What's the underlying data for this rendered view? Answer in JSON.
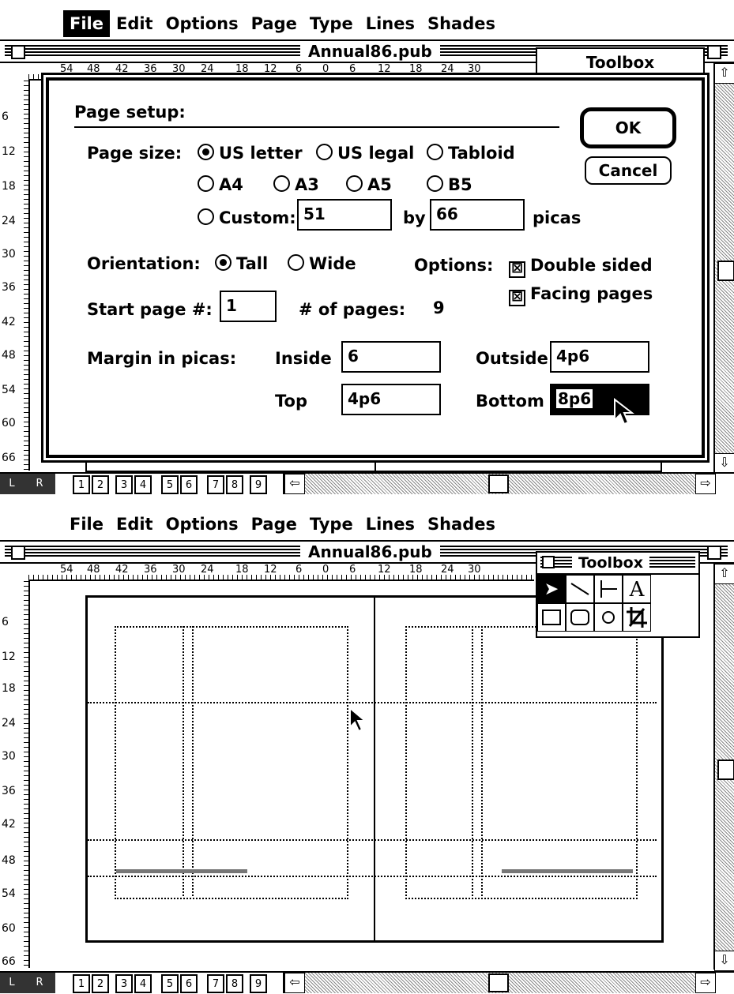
{
  "screen1": {
    "menu": [
      "File",
      "Edit",
      "Options",
      "Page",
      "Type",
      "Lines",
      "Shades"
    ],
    "selected_menu": "File",
    "window_title": "Annual86.pub",
    "toolbox_title": "Toolbox",
    "ruler_labels": [
      "54",
      "48",
      "42",
      "36",
      "30",
      "24",
      "18",
      "12",
      "6",
      "0",
      "6",
      "12",
      "18",
      "24",
      "30"
    ],
    "vruler_labels": [
      "6",
      "12",
      "18",
      "24",
      "30",
      "36",
      "42",
      "48",
      "54",
      "60",
      "66"
    ],
    "dialog": {
      "title": "Page setup:",
      "ok": "OK",
      "cancel": "Cancel",
      "page_size_label": "Page size:",
      "sizes_row1": [
        "US letter",
        "US legal",
        "Tabloid"
      ],
      "sizes_row2": [
        "A4",
        "A3",
        "A5",
        "B5"
      ],
      "custom_label": "Custom:",
      "custom_width": "51",
      "by_label": "by",
      "custom_height": "66",
      "picas_label": "picas",
      "orientation_label": "Orientation:",
      "orientation_options": [
        "Tall",
        "Wide"
      ],
      "options_label": "Options:",
      "double_sided": "Double sided",
      "facing_pages": "Facing pages",
      "start_page_label": "Start page #:",
      "start_page": "1",
      "num_pages_label": "# of pages:",
      "num_pages": "9",
      "margin_label": "Margin in picas:",
      "inside_label": "Inside",
      "inside": "6",
      "outside_label": "Outside",
      "outside": "4p6",
      "top_label": "Top",
      "top": "4p6",
      "bottom_label": "Bottom",
      "bottom": "8p6"
    },
    "lr": [
      "L",
      "R"
    ],
    "page_numbers": [
      "1",
      "2",
      "3",
      "4",
      "5",
      "6",
      "7",
      "8",
      "9"
    ]
  },
  "screen2": {
    "menu": [
      "File",
      "Edit",
      "Options",
      "Page",
      "Type",
      "Lines",
      "Shades"
    ],
    "window_title": "Annual86.pub",
    "toolbox_title": "Toolbox",
    "ruler_labels": [
      "54",
      "48",
      "42",
      "36",
      "30",
      "24",
      "18",
      "12",
      "6",
      "0",
      "6",
      "12",
      "18",
      "24",
      "30"
    ],
    "vruler_labels": [
      "6",
      "12",
      "18",
      "24",
      "30",
      "36",
      "42",
      "48",
      "54",
      "60",
      "66"
    ],
    "lr": [
      "L",
      "R"
    ],
    "page_numbers": [
      "1",
      "2",
      "3",
      "4",
      "5",
      "6",
      "7",
      "8",
      "9"
    ]
  }
}
